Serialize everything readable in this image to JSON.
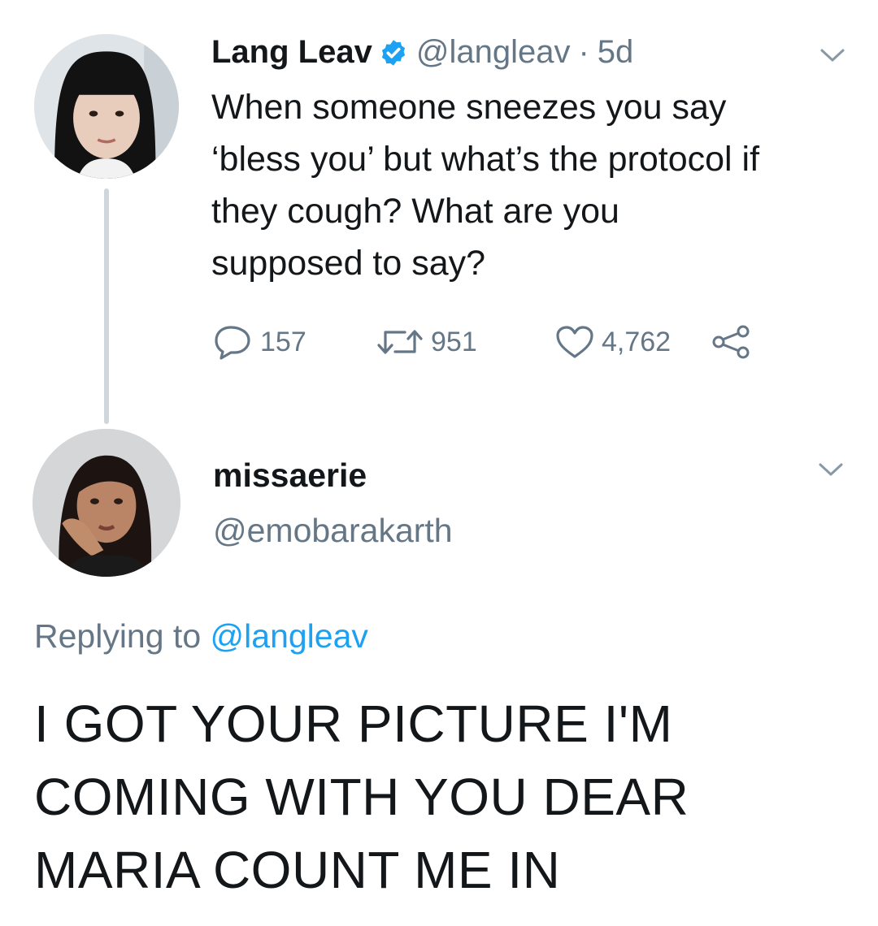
{
  "tweet": {
    "author": {
      "display_name": "Lang Leav",
      "handle": "@langleav",
      "verified": true,
      "avatar": "profile-photo-woman-dark-bangs"
    },
    "separator": "·",
    "time": "5d",
    "text_lines": [
      "When someone sneezes you say",
      "‘bless you’ but what’s the protocol if",
      "they cough? What are you",
      "supposed to say?"
    ],
    "actions": {
      "reply_count": "157",
      "retweet_count": "951",
      "like_count": "4,762",
      "icons": [
        "reply-icon",
        "retweet-icon",
        "like-icon",
        "share-icon"
      ]
    }
  },
  "reply": {
    "author": {
      "display_name": "missaerie",
      "handle": "@emobarakarth",
      "avatar": "profile-photo-woman-hand-on-cheek"
    },
    "replying_prefix": "Replying to",
    "replying_to": "@langleav",
    "text_lines": [
      "I GOT YOUR PICTURE I'M",
      "COMING WITH YOU DEAR",
      "MARIA COUNT ME IN"
    ]
  },
  "colors": {
    "text": "#14171a",
    "muted": "#657786",
    "link": "#1da1f2",
    "verified": "#1da1f2",
    "thread_line": "#cfd6dc"
  }
}
